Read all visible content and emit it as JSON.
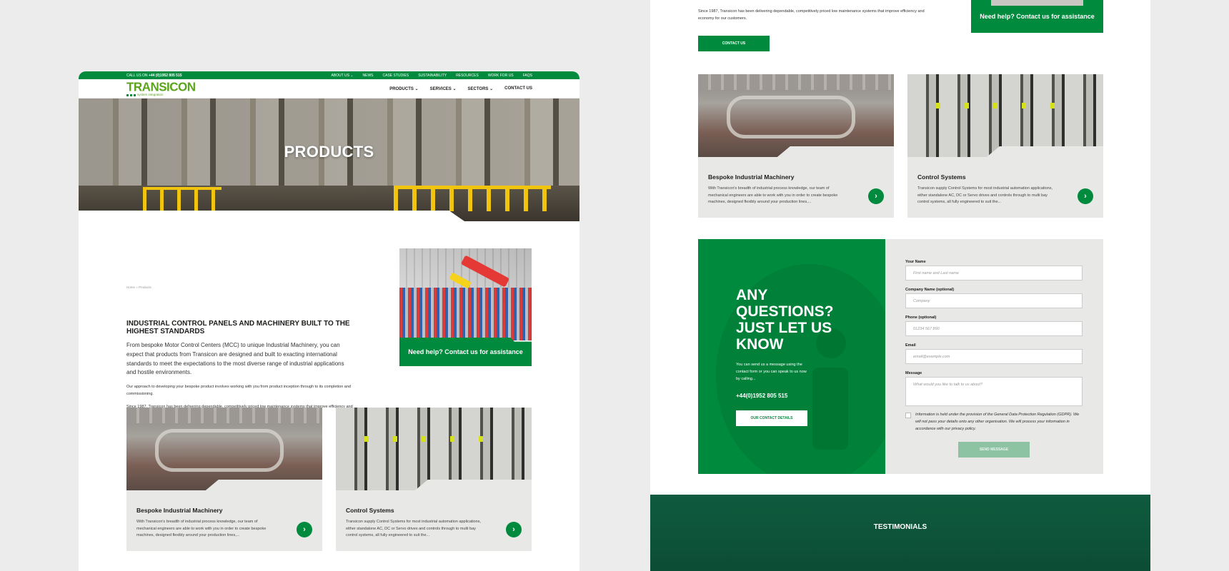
{
  "topbar": {
    "call_prefix": "CALL US ON ",
    "call_number": "+44 (0)1952 805 515",
    "links": [
      "ABOUT US ⌄",
      "NEWS",
      "CASE STUDIES",
      "SUSTAINABILITY",
      "RESOURCES",
      "WORK FOR US",
      "FAQS"
    ]
  },
  "brand": {
    "name": "TRANSICON",
    "tagline": "system integration"
  },
  "nav": [
    "PRODUCTS ⌄",
    "SERVICES ⌄",
    "SECTORS ⌄",
    "CONTACT US"
  ],
  "hero": {
    "title": "PRODUCTS"
  },
  "breadcrumb": "Home » Products",
  "intro": {
    "heading": "INDUSTRIAL CONTROL PANELS AND MACHINERY BUILT TO THE HIGHEST STANDARDS",
    "lead": "From bespoke Motor Control Centers (MCC) to unique Industrial Machinery, you can expect that products from Transicon are designed and built to exacting international standards to meet the expectations to the most diverse range of industrial applications and hostile environments.",
    "para1": "Our approach to developing your bespoke product involves working with you from product inception through to its completion and commissioning.",
    "para2": "Since 1987, Transicon has been delivering dependable, competitively priced low maintenance systems that improve efficiency and economy for our customers.",
    "button": "CONTACT US"
  },
  "help_card": {
    "label": "Need help? Contact us for assistance"
  },
  "cards": [
    {
      "title": "Bespoke Industrial Machinery",
      "text": "With Transicon's breadth of industrial process knowledge, our team of mechanical engineers are able to work with you in order to create bespoke machines, designed flexibly around your production lines,...",
      "arrow": "›"
    },
    {
      "title": "Control Systems",
      "text": "Transicon supply Control Systems for most industrial automation applications, either standalone AC, DC or Servo drives and controls through to multi bay control systems, all fully engineered to suit the...",
      "arrow": "›"
    }
  ],
  "contact": {
    "heading": "ANY QUESTIONS? JUST LET US KNOW",
    "info": "You can send us a message using the contact form or you can speak to us now by calling...",
    "phone": "+44(0)1952 805 515",
    "details_button": "OUR CONTACT DETAILS",
    "fields": [
      {
        "label": "Your Name",
        "placeholder": "First name and Last name"
      },
      {
        "label": "Company Name (optional)",
        "placeholder": "Company"
      },
      {
        "label": "Phone (optional)",
        "placeholder": "01234 567 890"
      },
      {
        "label": "Email",
        "placeholder": "email@example.com"
      },
      {
        "label": "Message",
        "placeholder": "What would you like to talk to us about?"
      }
    ],
    "gdpr": "Information is held under the provision of the General Data Protection Regulation (GDPR). We will not pass your details onto any other organisation. We will process your information in accordance with our privacy policy.",
    "send_button": "SEND MESSAGE"
  },
  "testimonials": {
    "title": "TESTIMONIALS"
  },
  "colors": {
    "brand_green": "#008a3d",
    "logo_green": "#5aa51b",
    "card_grey": "#e8e8e6",
    "dark_green": "#0f5b3f"
  }
}
